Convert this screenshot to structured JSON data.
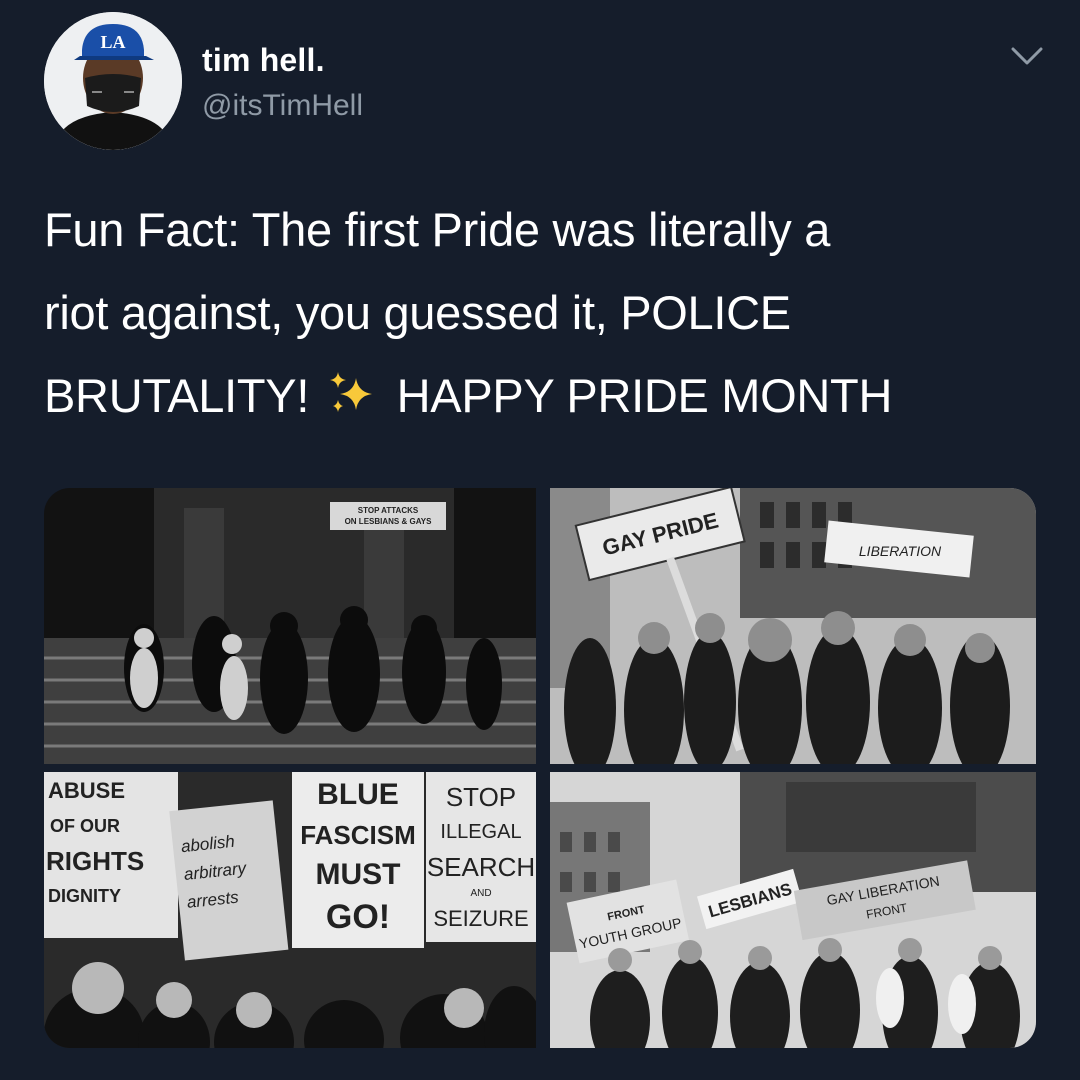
{
  "user": {
    "display_name": "tim hell.",
    "handle": "@itsTimHell",
    "cap_logo": "LA"
  },
  "menu": {
    "icon": "chevron-down-icon"
  },
  "tweet": {
    "line1": "Fun Fact: The first Pride was literally a",
    "line2": "riot against, you guessed it, POLICE",
    "line3_before": "BRUTALITY!",
    "line3_after": "HAPPY PRIDE MONTH",
    "emoji": "sparkles-icon"
  },
  "media": {
    "photo1": {
      "sign_line1": "STOP ATTACKS",
      "sign_line2": "ON LESBIANS & GAYS"
    },
    "photo2": {
      "sign_main": "GAY PRIDE",
      "sign_right": "LIBERATION"
    },
    "photo3": {
      "sign1_l1": "ABUSE",
      "sign1_l2": "OF OUR",
      "sign1_l3": "RIGHTS",
      "sign1_l4": "DIGNITY",
      "sign2_l1": "abolish",
      "sign2_l2": "arbitrary",
      "sign2_l3": "arrests",
      "sign3_l1": "BLUE",
      "sign3_l2": "FASCISM",
      "sign3_l3": "MUST",
      "sign3_l4": "GO!",
      "sign4_l1": "STOP",
      "sign4_l2": "ILLEGAL",
      "sign4_l3": "SEARCH",
      "sign4_l4": "AND",
      "sign4_l5": "SEIZURE"
    },
    "photo4": {
      "banner1_l1": "FRONT",
      "banner1_l2": "YOUTH GROUP",
      "banner2": "LESBIANS",
      "banner3_l1": "GAY LIBERATION",
      "banner3_l2": "FRONT"
    }
  }
}
